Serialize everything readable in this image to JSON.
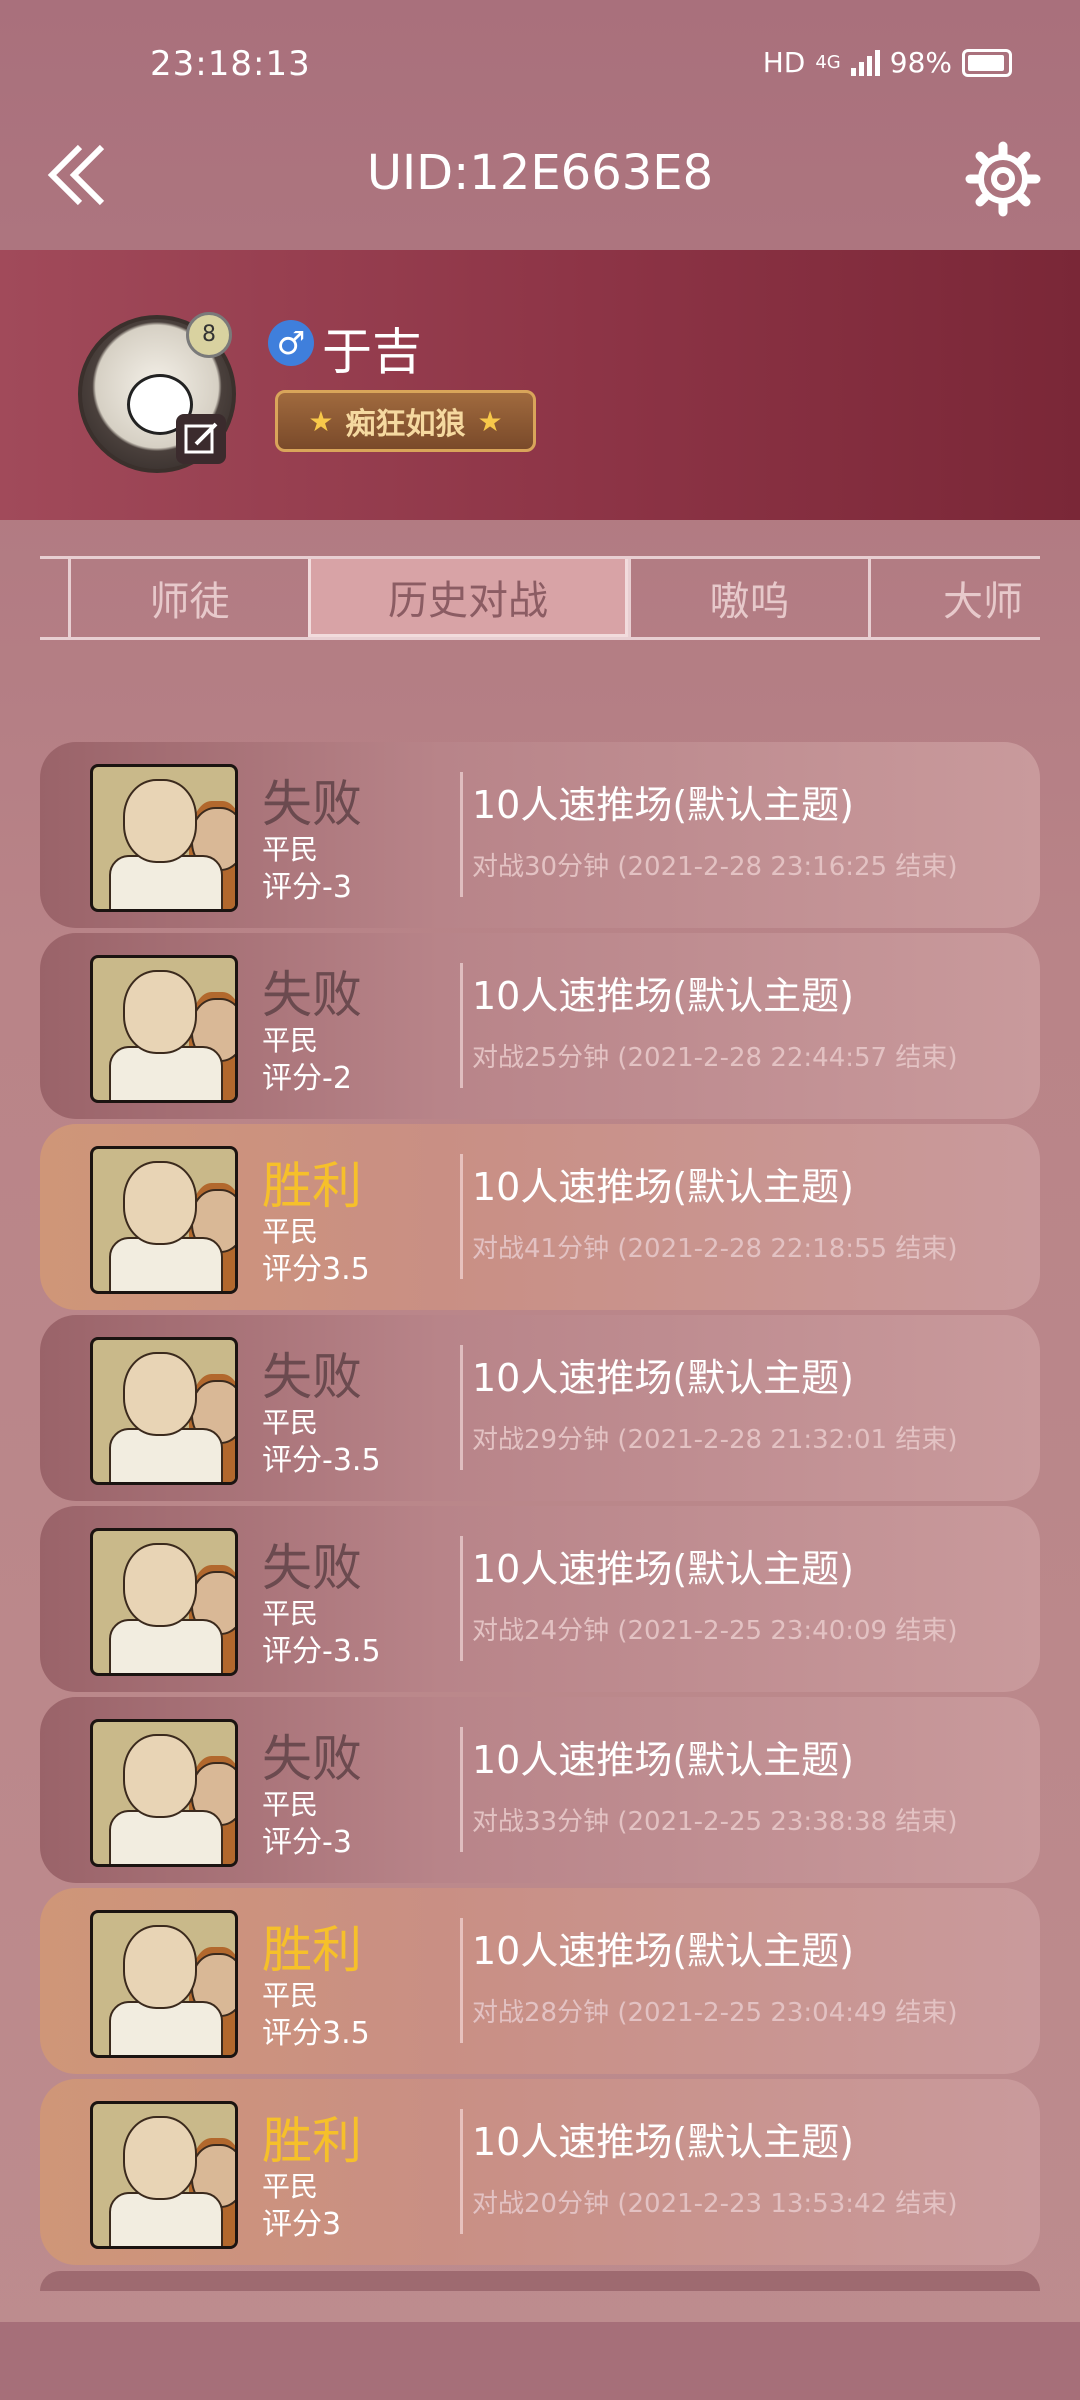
{
  "status": {
    "time": "23:18:13",
    "hd": "HD",
    "network": "4G",
    "battery": "98%"
  },
  "header": {
    "title": "UID:12E663E8"
  },
  "profile": {
    "level": "8",
    "gender_symbol": "♂",
    "name": "于吉",
    "badge": "痴狂如狼"
  },
  "tabs": [
    "师徒",
    "历史对战",
    "嗷呜",
    "大师"
  ],
  "matches": [
    {
      "result": "失败",
      "win": false,
      "role": "平民",
      "score": "评分-3",
      "mode": "10人速推场(默认主题)",
      "meta": "对战30分钟 (2021-2-28 23:16:25 结束)"
    },
    {
      "result": "失败",
      "win": false,
      "role": "平民",
      "score": "评分-2",
      "mode": "10人速推场(默认主题)",
      "meta": "对战25分钟 (2021-2-28 22:44:57 结束)"
    },
    {
      "result": "胜利",
      "win": true,
      "role": "平民",
      "score": "评分3.5",
      "mode": "10人速推场(默认主题)",
      "meta": "对战41分钟 (2021-2-28 22:18:55 结束)"
    },
    {
      "result": "失败",
      "win": false,
      "role": "平民",
      "score": "评分-3.5",
      "mode": "10人速推场(默认主题)",
      "meta": "对战29分钟 (2021-2-28 21:32:01 结束)"
    },
    {
      "result": "失败",
      "win": false,
      "role": "平民",
      "score": "评分-3.5",
      "mode": "10人速推场(默认主题)",
      "meta": "对战24分钟 (2021-2-25 23:40:09 结束)"
    },
    {
      "result": "失败",
      "win": false,
      "role": "平民",
      "score": "评分-3",
      "mode": "10人速推场(默认主题)",
      "meta": "对战33分钟 (2021-2-25 23:38:38 结束)"
    },
    {
      "result": "胜利",
      "win": true,
      "role": "平民",
      "score": "评分3.5",
      "mode": "10人速推场(默认主题)",
      "meta": "对战28分钟 (2021-2-25 23:04:49 结束)"
    },
    {
      "result": "胜利",
      "win": true,
      "role": "平民",
      "score": "评分3",
      "mode": "10人速推场(默认主题)",
      "meta": "对战20分钟 (2021-2-23 13:53:42 结束)"
    }
  ]
}
